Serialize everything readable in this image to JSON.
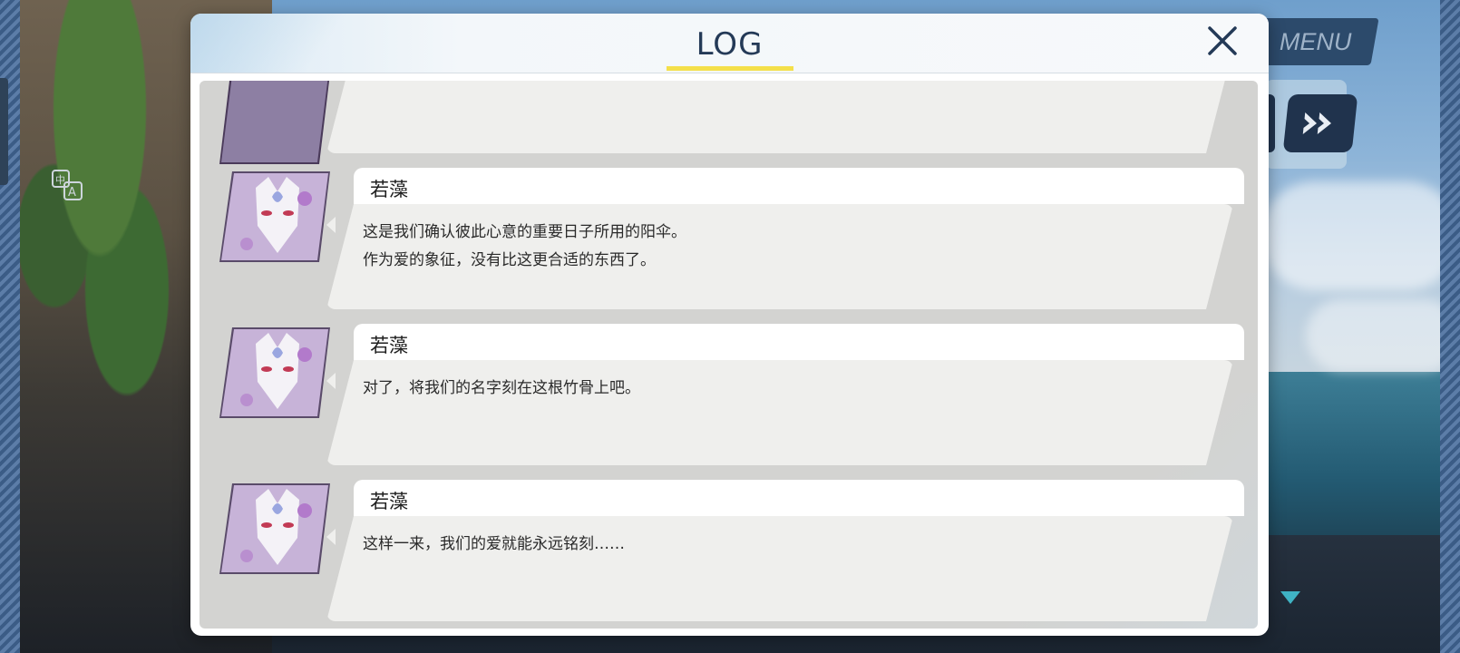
{
  "window": {
    "title": "LOG"
  },
  "hud": {
    "menu_label": "MENU",
    "icons": {
      "close": "close-icon",
      "translate": "translate-icon",
      "skip": "fast-forward-icon",
      "scroll": "triangle-down-icon"
    }
  },
  "log": {
    "entries": [
      {
        "speaker": "",
        "lines": []
      },
      {
        "speaker": "若藻",
        "lines": [
          "这是我们确认彼此心意的重要日子所用的阳伞。",
          "作为爱的象征，没有比这更合适的东西了。"
        ]
      },
      {
        "speaker": "若藻",
        "lines": [
          "对了，将我们的名字刻在这根竹骨上吧。"
        ]
      },
      {
        "speaker": "若藻",
        "lines": [
          "这样一来，我们的爱就能永远铭刻……"
        ]
      }
    ]
  },
  "colors": {
    "accent_underline": "#f4e04a",
    "title_text": "#243a57",
    "menu_bg": "#2c4a6b",
    "log_bg": "#d3d3d1",
    "bubble_bg": "#efefed"
  }
}
